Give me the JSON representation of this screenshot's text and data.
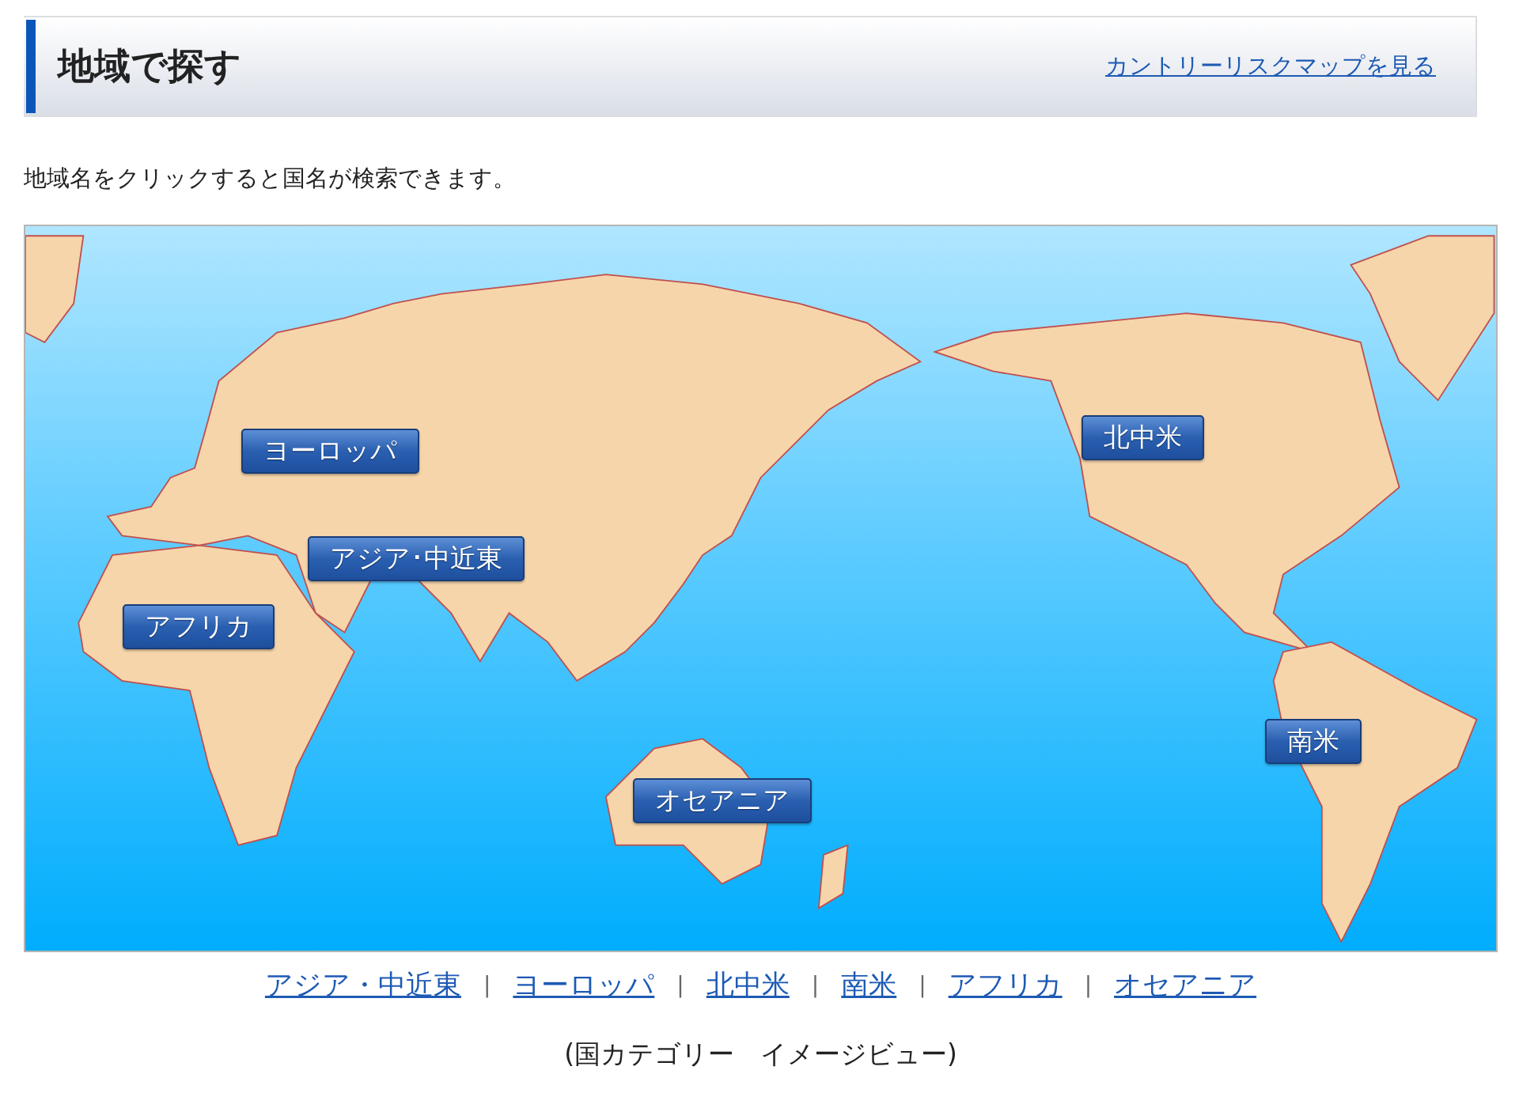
{
  "header": {
    "title": "地域で探す",
    "link": "カントリーリスクマップを見る"
  },
  "instruction": "地域名をクリックすると国名が検索できます。",
  "map": {
    "regions": [
      {
        "label": "ヨーロッパ"
      },
      {
        "label": "アジア･中近東"
      },
      {
        "label": "アフリカ"
      },
      {
        "label": "北中米"
      },
      {
        "label": "南米"
      },
      {
        "label": "オセアニア"
      }
    ]
  },
  "region_links": {
    "separator": "|",
    "items": [
      "アジア・中近東",
      "ヨーロッパ",
      "北中米",
      "南米",
      "アフリカ",
      "オセアニア"
    ]
  },
  "caption": "(国カテゴリー　イメージビュー)"
}
